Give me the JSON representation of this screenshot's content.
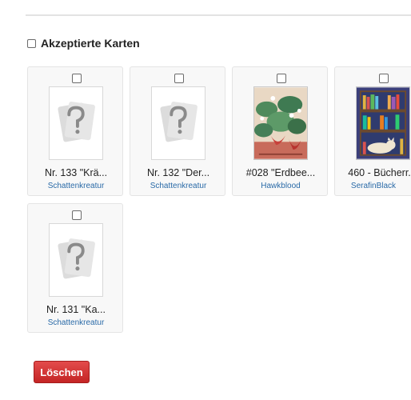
{
  "section": {
    "title": "Akzeptierte Karten",
    "checked": false
  },
  "cards": [
    {
      "title": "Nr. 133 \"Krä...",
      "author": "Schattenkreatur",
      "image": "placeholder-question-icon",
      "checked": false
    },
    {
      "title": "Nr. 132 \"Der...",
      "author": "Schattenkreatur",
      "image": "placeholder-question-icon",
      "checked": false
    },
    {
      "title": "#028 \"Erdbee...",
      "author": "Hawkblood",
      "image": "strawberry-plant-artwork",
      "checked": false
    },
    {
      "title": "460 - Bücherr...",
      "author": "SerafinBlack",
      "image": "bookshelf-cat-artwork",
      "checked": false
    },
    {
      "title": "Nr. 131 \"Ka...",
      "author": "Schattenkreatur",
      "image": "placeholder-question-icon",
      "checked": false
    }
  ],
  "actions": {
    "delete_label": "Löschen"
  },
  "colors": {
    "link": "#2a6aa7",
    "delete_button": "#d63434"
  }
}
